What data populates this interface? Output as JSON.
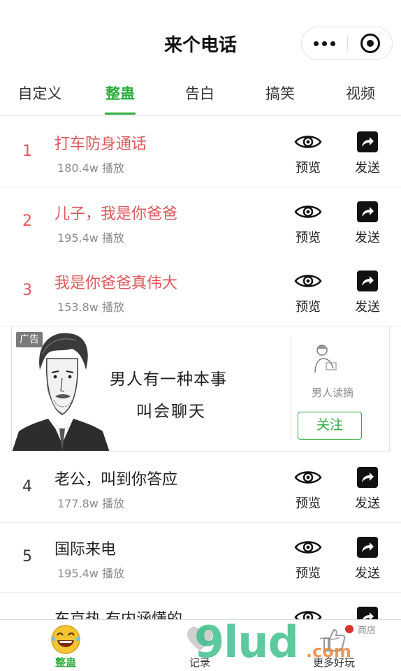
{
  "header": {
    "title": "来个电话"
  },
  "tabs": [
    {
      "label": "自定义",
      "active": false
    },
    {
      "label": "整蛊",
      "active": true
    },
    {
      "label": "告白",
      "active": false
    },
    {
      "label": "搞笑",
      "active": false
    },
    {
      "label": "视频",
      "active": false
    }
  ],
  "actions": {
    "preview_label": "预览",
    "send_label": "发送"
  },
  "list": [
    {
      "rank": "1",
      "title": "打车防身通话",
      "plays": "180.4w 播放",
      "hot": true
    },
    {
      "rank": "2",
      "title": "儿子，我是你爸爸",
      "plays": "195.4w 播放",
      "hot": true
    },
    {
      "rank": "3",
      "title": "我是你爸爸真伟大",
      "plays": "153.8w 播放",
      "hot": true
    },
    {
      "rank": "4",
      "title": "老公，叫到你答应",
      "plays": "177.8w 播放",
      "hot": false
    },
    {
      "rank": "5",
      "title": "国际来电",
      "plays": "195.4w 播放",
      "hot": false
    },
    {
      "rank": "",
      "title": "东京热 有内涵懂的",
      "plays": "",
      "hot": false
    }
  ],
  "ad": {
    "tag": "广告",
    "line1": "男人有一种本事",
    "line2": "叫会聊天",
    "account_name": "男人读摘",
    "follow_label": "关注"
  },
  "bottom_nav": [
    {
      "label": "整蛊",
      "icon": "laughing-face-icon",
      "active": true
    },
    {
      "label": "记录",
      "icon": "heart-icon",
      "active": false
    },
    {
      "label": "更多好玩",
      "icon": "thumbs-up-icon",
      "active": false
    }
  ],
  "watermark": {
    "text": "9lud",
    "suffix": ".com",
    "shop": "商店"
  },
  "colors": {
    "accent": "#2aae3c",
    "hot": "#e0575a",
    "muted": "#8a8a8a"
  }
}
